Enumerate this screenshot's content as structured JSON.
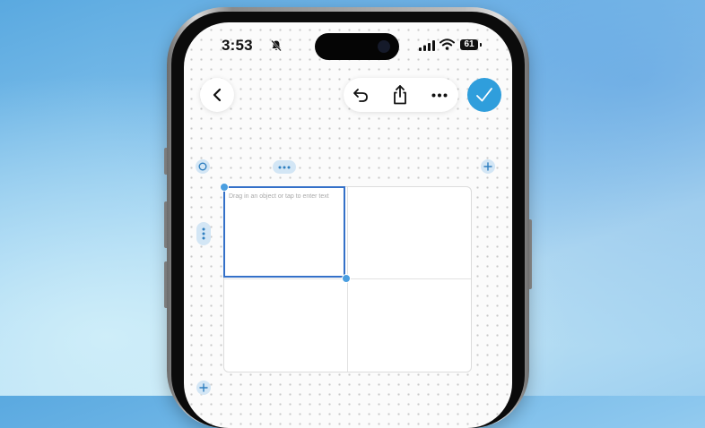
{
  "status_bar": {
    "time": "3:53",
    "silent_icon": "bell-slash-icon",
    "battery": "61"
  },
  "toolbar": {
    "back_icon": "chevron-left-icon",
    "undo_icon": "undo-icon",
    "share_icon": "share-icon",
    "more_icon": "ellipsis-icon",
    "done_icon": "checkmark-icon"
  },
  "table": {
    "placeholder": "Drag in an object or tap to enter text",
    "columns": 2,
    "rows": 2
  },
  "colors": {
    "accent": "#2f9edc",
    "selection": "#3470c8",
    "handle_bg": "#d3e6f5"
  }
}
